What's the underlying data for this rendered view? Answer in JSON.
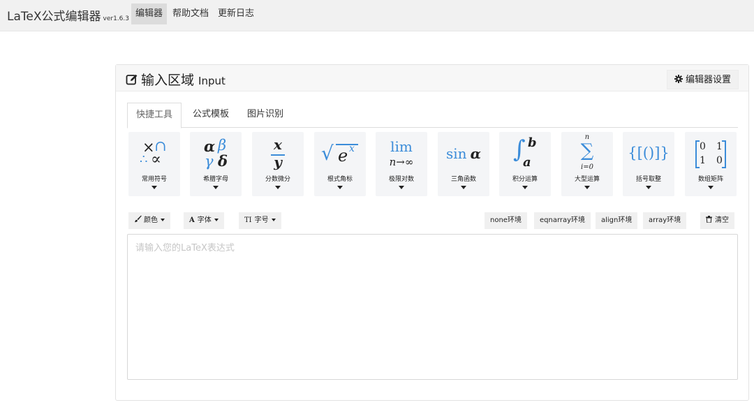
{
  "navbar": {
    "brand": "LaTeX公式编辑器",
    "version": "ver1.6.3",
    "items": [
      {
        "label": "编辑器",
        "active": true
      },
      {
        "label": "帮助文档",
        "active": false
      },
      {
        "label": "更新日志",
        "active": false
      }
    ]
  },
  "panel": {
    "title": "输入区域",
    "title_en": "Input",
    "settings_label": "编辑器设置"
  },
  "tabs": [
    {
      "label": "快捷工具",
      "active": true
    },
    {
      "label": "公式模板",
      "active": false
    },
    {
      "label": "图片识别",
      "active": false
    }
  ],
  "tools": [
    {
      "label": "常用符号",
      "symbols": {
        "a": "×",
        "b": "∩",
        "c": "∴",
        "d": "∝"
      }
    },
    {
      "label": "希腊字母",
      "symbols": {
        "a": "α",
        "b": "β",
        "c": "γ",
        "d": "δ"
      }
    },
    {
      "label": "分数微分",
      "symbols": {
        "num": "x",
        "den": "y"
      }
    },
    {
      "label": "根式角标",
      "symbols": {
        "root": "√",
        "base": "e",
        "sup": "x"
      }
    },
    {
      "label": "极限对数",
      "symbols": {
        "top": "lim",
        "bottom": "n→∞"
      }
    },
    {
      "label": "三角函数",
      "symbols": {
        "fn": "sin",
        "var": "α"
      }
    },
    {
      "label": "积分运算",
      "symbols": {
        "int": "∫",
        "upper": "b",
        "lower": "a"
      }
    },
    {
      "label": "大型运算",
      "symbols": {
        "sum": "∑",
        "upper": "n",
        "lower": "i=0"
      }
    },
    {
      "label": "括号取整",
      "symbols": {
        "text": "{[()]}"
      }
    },
    {
      "label": "数组矩阵",
      "symbols": {
        "r1c1": "0",
        "r1c2": "1",
        "r2c1": "1",
        "r2c2": "0"
      }
    }
  ],
  "format": {
    "color_label": "颜色",
    "font_label": "字体",
    "size_label": "字号",
    "size_icon_text": "TI",
    "font_icon_text": "A"
  },
  "envs": {
    "none": "none环境",
    "eqnarray": "eqnarray环境",
    "align": "align环境",
    "array": "array环境",
    "clear": "清空"
  },
  "editor": {
    "value": "",
    "placeholder": "请输入您的LaTeX表达式"
  },
  "colors": {
    "accent_blue": "#3b8cd9",
    "navbar_bg": "#f1f1f1",
    "card_bg": "#f4f5f7"
  }
}
